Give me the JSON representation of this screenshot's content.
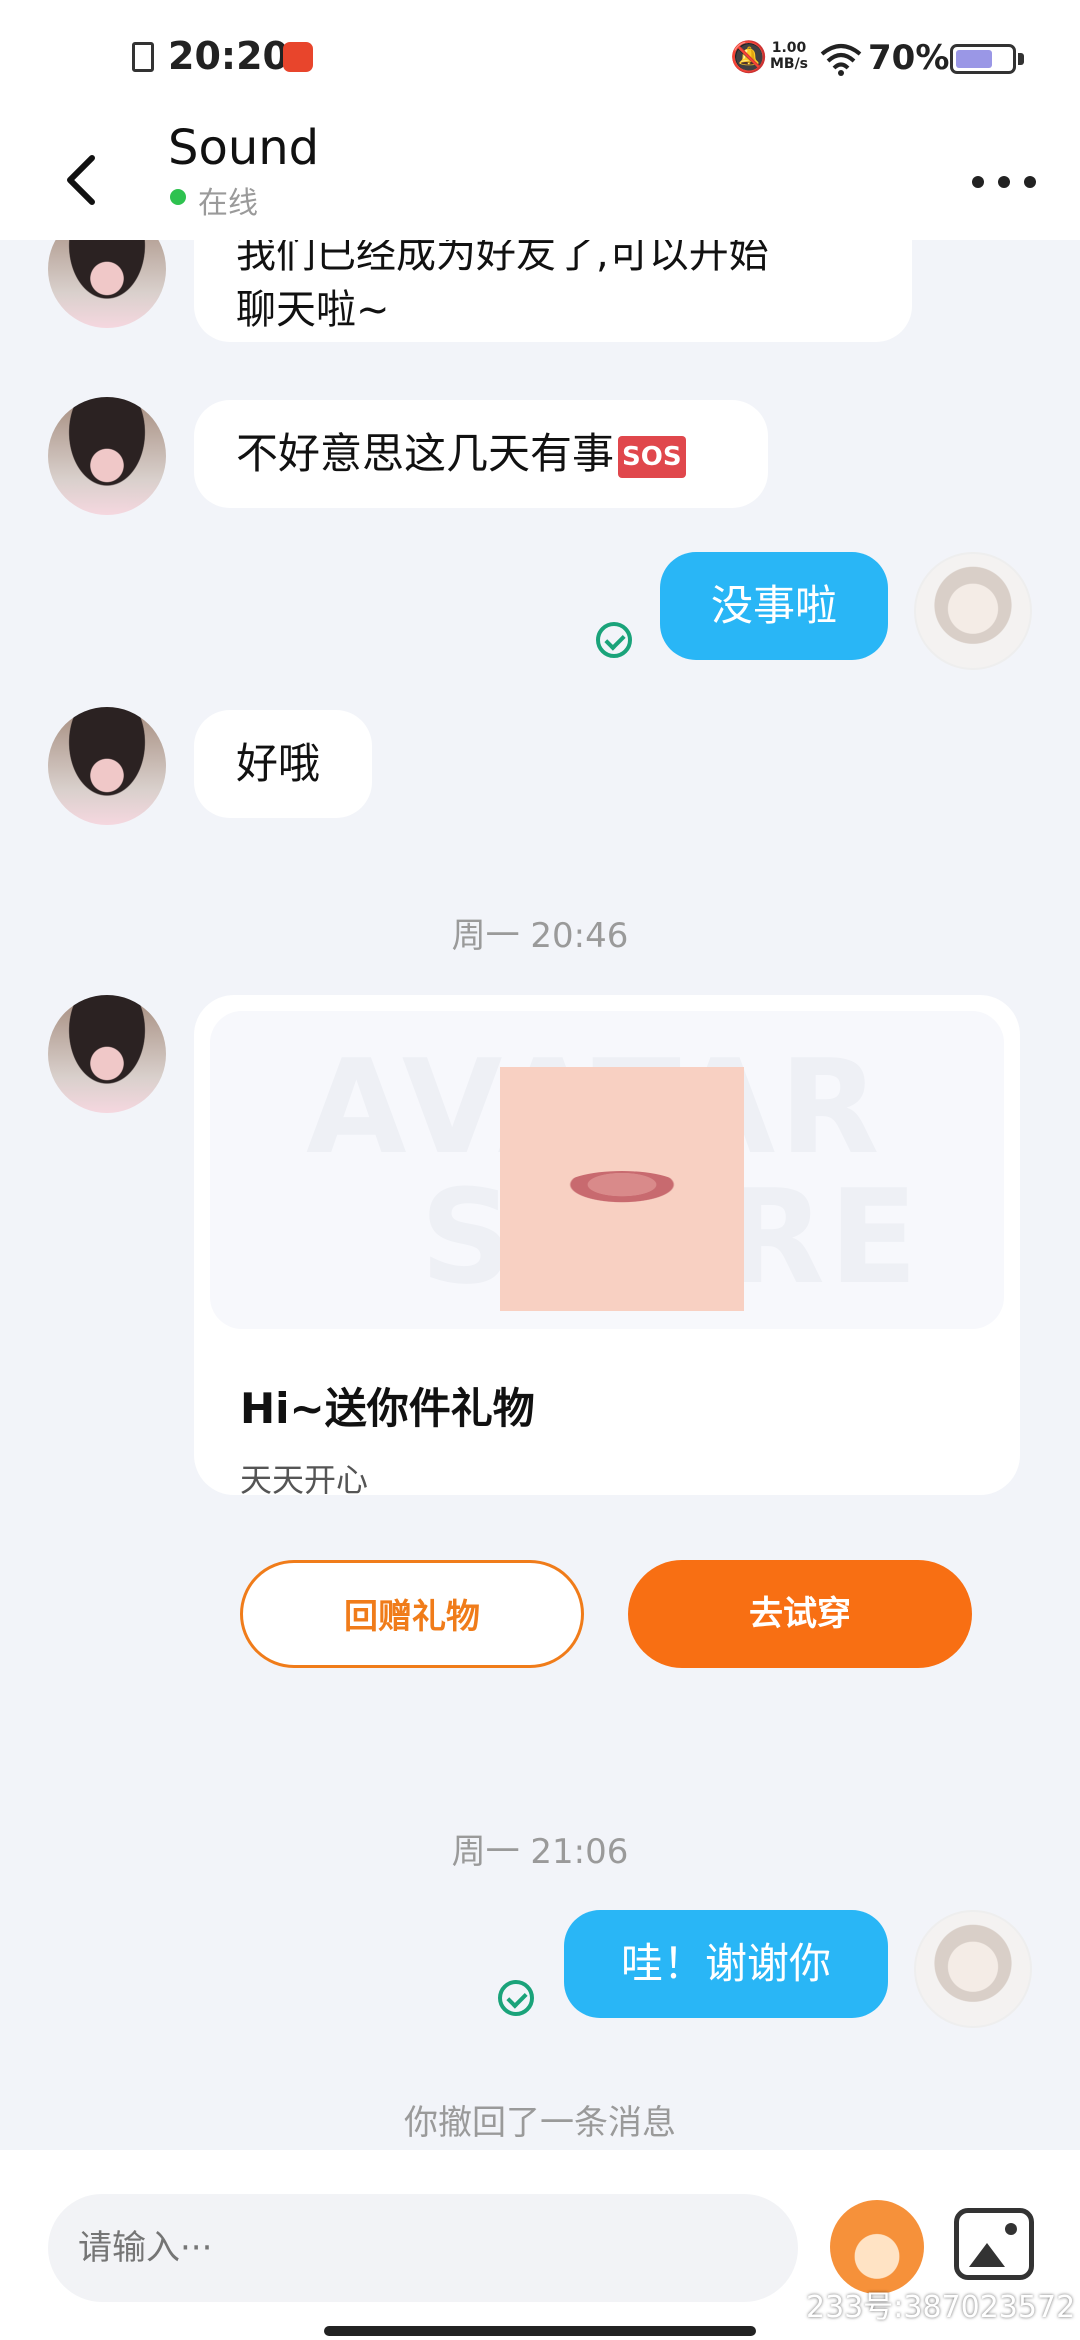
{
  "status_bar": {
    "time": "20:20",
    "net_speed": "1.00",
    "net_unit": "MB/s",
    "battery": "70%",
    "battery_level": 0.7
  },
  "header": {
    "title": "Sound",
    "status": "在线"
  },
  "messages": [
    {
      "from": "other",
      "text_line1": "我们已经成为好友了,可以开始",
      "text_line2": "聊天啦~"
    },
    {
      "from": "other",
      "text": "不好意思这几天有事",
      "emoji": "SOS"
    },
    {
      "from": "me",
      "text": "没事啦"
    },
    {
      "from": "other",
      "text": "好哦"
    }
  ],
  "timestamp_1": "周一  20:46",
  "gift_card": {
    "watermark": "AVATAR STORE",
    "title": "Hi~送你件礼物",
    "subtitle": "天天开心",
    "btn_return": "回赠礼物",
    "btn_try": "去试穿"
  },
  "timestamp_2": "周一  21:06",
  "message_me_2": "哇！谢谢你",
  "recall_notice": "你撤回了一条消息",
  "input": {
    "placeholder": "请输入···"
  },
  "id_tag": "233号:387023572",
  "colors": {
    "outgoing_bubble": "#29b6f6",
    "accent_orange": "#f86f13",
    "online": "#2ec24f",
    "read_check": "#1aa37a"
  }
}
